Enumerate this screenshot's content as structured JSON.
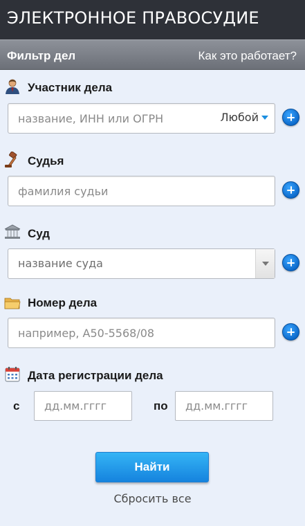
{
  "header": {
    "app_title": "ЭЛЕКТРОННОЕ ПРАВОСУДИЕ"
  },
  "filter_bar": {
    "title": "Фильтр дел",
    "help_link": "Как это работает?"
  },
  "fields": {
    "participant": {
      "label": "Участник дела",
      "icon": "person-icon",
      "placeholder": "название, ИНН или ОГРН",
      "role_select": "Любой"
    },
    "judge": {
      "label": "Судья",
      "icon": "gavel-icon",
      "placeholder": "фамилия судьи"
    },
    "court": {
      "label": "Суд",
      "icon": "courthouse-icon",
      "placeholder": "название суда"
    },
    "case_number": {
      "label": "Номер дела",
      "icon": "folder-icon",
      "placeholder": "например, А50-5568/08"
    },
    "registration_date": {
      "label": "Дата регистрации дела",
      "icon": "calendar-icon",
      "from_label": "с",
      "to_label": "по",
      "from_placeholder": "дд.мм.гггг",
      "to_placeholder": "дд.мм.гггг"
    }
  },
  "actions": {
    "search_button": "Найти",
    "reset_link": "Сбросить все"
  },
  "colors": {
    "header_bg": "#2e3138",
    "filter_bar_bg": "#7a7e86",
    "page_bg": "#eaf0fa",
    "accent_blue": "#1583de"
  }
}
